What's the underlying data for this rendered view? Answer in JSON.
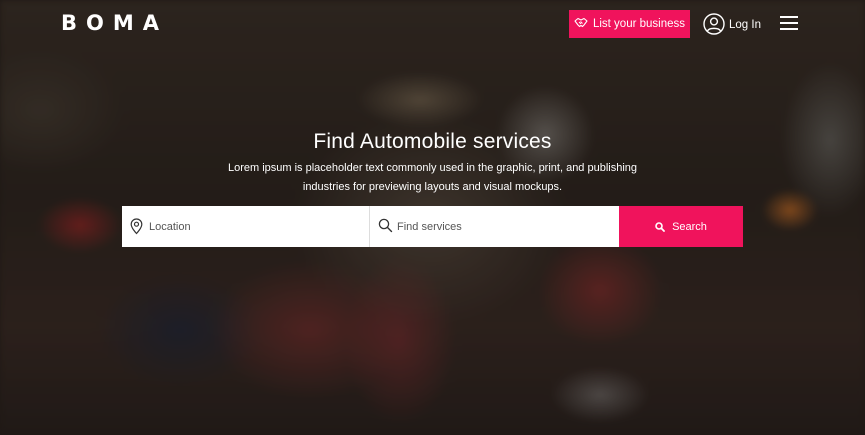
{
  "header": {
    "logo": "BOMA",
    "list_business_label": "List your business",
    "login_label": "Log In"
  },
  "hero": {
    "title": "Find Automobile services",
    "subtitle": "Lorem ipsum is placeholder text commonly used in the graphic, print, and publishing industries for previewing layouts and visual mockups."
  },
  "search": {
    "location_placeholder": "Location",
    "services_placeholder": "Find services",
    "button_label": "Search"
  },
  "colors": {
    "accent": "#f0135c"
  },
  "icons": {
    "list_business": "handshake-icon",
    "login": "user-circle-icon",
    "menu": "hamburger-menu-icon",
    "location": "map-pin-icon",
    "services": "search-icon",
    "search_button": "search-icon"
  }
}
